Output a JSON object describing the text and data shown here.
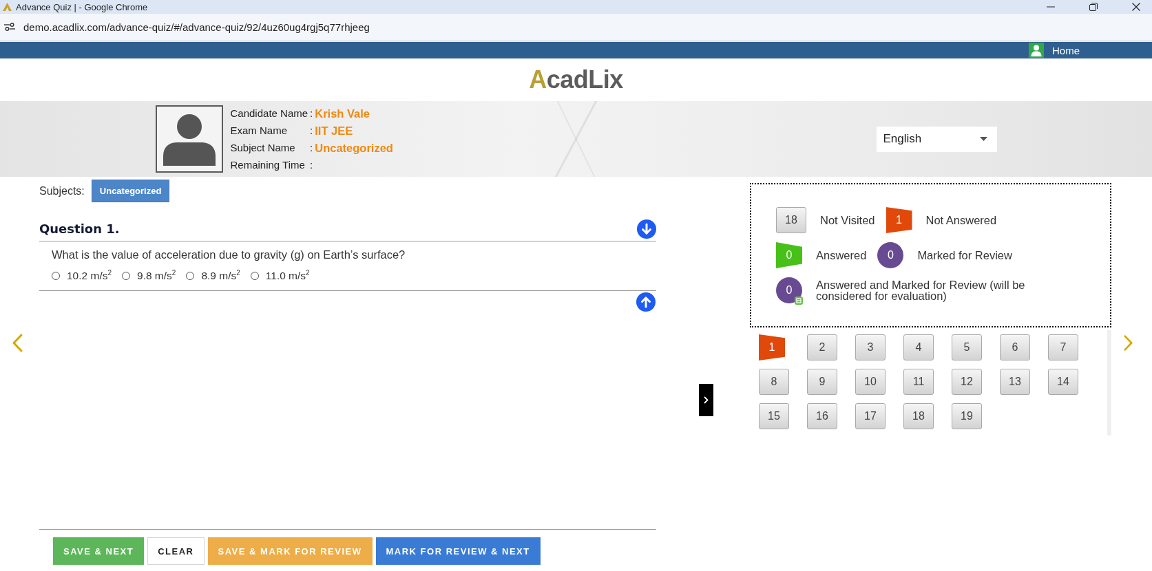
{
  "browser": {
    "title": "Advance Quiz | - Google Chrome",
    "url": "demo.acadlix.com/advance-quiz/#/advance-quiz/92/4uz60ug4rgj5q77rhjeeg"
  },
  "nav": {
    "home": "Home"
  },
  "logo": {
    "text": "AcadLix"
  },
  "candidate": {
    "fields": [
      {
        "label": "Candidate Name",
        "separator": ":",
        "value": "Krish Vale"
      },
      {
        "label": "Exam Name",
        "separator": ":",
        "value": "IIT JEE"
      },
      {
        "label": "Subject Name",
        "separator": ":",
        "value": "Uncategorized"
      },
      {
        "label": "Remaining Time",
        "separator": ":"
      }
    ]
  },
  "language": {
    "value": "English"
  },
  "subjects": {
    "label": "Subjects:",
    "items": [
      {
        "label": "Uncategorized",
        "selected": true
      }
    ]
  },
  "question": {
    "title": "Question 1.",
    "text": "What is the value of acceleration due to gravity (g) on Earth’s surface?",
    "options": [
      {
        "label": "10.2 m/s$^{2}$",
        "selected": false
      },
      {
        "label": "9.8 m/s$^{2}$",
        "selected": false
      },
      {
        "label": "8.9 m/s$^{2}$",
        "selected": false
      },
      {
        "label": "11.0 m/s$^{2}$",
        "selected": false
      }
    ]
  },
  "legend": {
    "rows": [
      [
        {
          "kind": "not_visited",
          "count": "18",
          "label": "Not Visited"
        },
        {
          "kind": "not_answered",
          "count": "1",
          "label": "Not Answered"
        }
      ],
      [
        {
          "kind": "answered",
          "count": "0",
          "label": "Answered"
        },
        {
          "kind": "marked",
          "count": "0",
          "label": "Marked for Review"
        }
      ],
      [
        {
          "kind": "answered_marked",
          "count": "0",
          "label": "Answered and Marked for Review (will be considered for evaluation)"
        }
      ]
    ]
  },
  "palette": {
    "questions": [
      {
        "number": "1",
        "kind": "not_answered"
      },
      {
        "number": "2",
        "kind": "not_visited"
      },
      {
        "number": "3",
        "kind": "not_visited"
      },
      {
        "number": "4",
        "kind": "not_visited"
      },
      {
        "number": "5",
        "kind": "not_visited"
      },
      {
        "number": "6",
        "kind": "not_visited"
      },
      {
        "number": "7",
        "kind": "not_visited"
      },
      {
        "number": "8",
        "kind": "not_visited"
      },
      {
        "number": "9",
        "kind": "not_visited"
      },
      {
        "number": "10",
        "kind": "not_visited"
      },
      {
        "number": "11",
        "kind": "not_visited"
      },
      {
        "number": "12",
        "kind": "not_visited"
      },
      {
        "number": "13",
        "kind": "not_visited"
      },
      {
        "number": "14",
        "kind": "not_visited"
      },
      {
        "number": "15",
        "kind": "not_visited"
      },
      {
        "number": "16",
        "kind": "not_visited"
      },
      {
        "number": "17",
        "kind": "not_visited"
      },
      {
        "number": "18",
        "kind": "not_visited"
      },
      {
        "number": "19",
        "kind": "not_visited"
      }
    ]
  },
  "actions": [
    {
      "kind": "save_next",
      "label": "SAVE & NEXT"
    },
    {
      "kind": "clear",
      "label": "CLEAR"
    },
    {
      "kind": "save_mark",
      "label": "SAVE & MARK FOR REVIEW"
    },
    {
      "kind": "mark_next",
      "label": "MARK FOR REVIEW & NEXT"
    }
  ]
}
